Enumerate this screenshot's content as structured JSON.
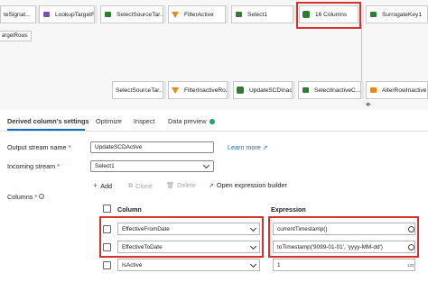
{
  "flow": {
    "row1": [
      {
        "label": "teSignat...",
        "icon": "source",
        "color": "#4a9fd8"
      },
      {
        "label": "LookupTargetR...",
        "icon": "lookup",
        "color": "#7b4fb8"
      },
      {
        "label": "SelectSourceTar...",
        "icon": "select",
        "color": "#2e7d32"
      },
      {
        "label": "FilterActive",
        "icon": "filter",
        "color": "#e8891a"
      },
      {
        "label": "Select1",
        "icon": "select",
        "color": "#2e7d32"
      },
      {
        "label": "16 Columns",
        "icon": "derived-column",
        "color": "#2e7d32"
      },
      {
        "label": "SurrogateKey1",
        "icon": "select",
        "color": "#2e7d32"
      }
    ],
    "sub_label": "argetRows",
    "row2": [
      {
        "label": "SelectSourceTar...",
        "icon": "select",
        "color": "#2e7d32"
      },
      {
        "label": "FilterInactiveRo...",
        "icon": "filter",
        "color": "#e8891a"
      },
      {
        "label": "UpdateSCDInac...",
        "icon": "derived-column",
        "color": "#2e7d32"
      },
      {
        "label": "SelectInactiveC...",
        "icon": "select",
        "color": "#2e7d32"
      },
      {
        "label": "AlterRowInactive",
        "icon": "alter-row",
        "color": "#e8891a"
      }
    ]
  },
  "tabs": [
    "Derived column's settings",
    "Optimize",
    "Inspect",
    "Data preview"
  ],
  "form": {
    "output_stream_label": "Output stream name",
    "output_stream_value": "UpdateSCDActive",
    "learn_more": "Learn more",
    "incoming_stream_label": "Incoming stream",
    "incoming_stream_value": "Select1",
    "columns_label": "Columns"
  },
  "toolbar": {
    "add": "Add",
    "clone": "Clone",
    "delete": "Delete",
    "open_builder": "Open expression builder"
  },
  "table": {
    "column_header": "Column",
    "expression_header": "Expression",
    "rows": [
      {
        "column": "EffectiveFromDate",
        "expression": "currentTimestamp()"
      },
      {
        "column": "EffectiveToDate",
        "expression": "toTimestamp('9099-01-01', 'yyyy-MM-dd')"
      },
      {
        "column": "IsActive",
        "expression": "1"
      }
    ]
  },
  "colors": {
    "accent": "#0f6cbd",
    "highlight": "#d9302b",
    "status_ok": "#21a366"
  }
}
